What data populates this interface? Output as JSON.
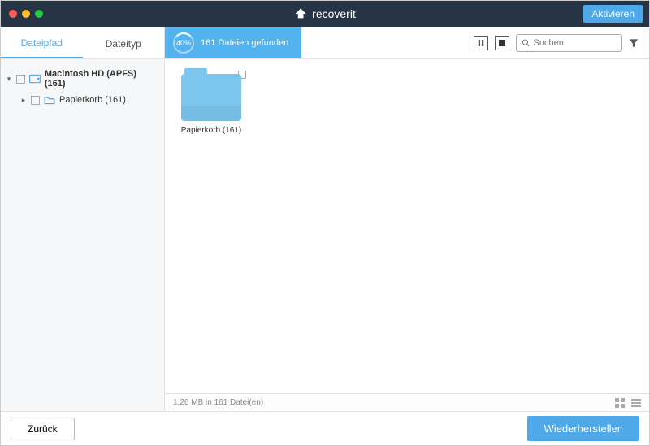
{
  "header": {
    "app_name": "recoverit",
    "activate_label": "Aktivieren"
  },
  "tabs": {
    "filepath": "Dateipfad",
    "filetype": "Dateityp"
  },
  "scan": {
    "percent": "40%",
    "status": "161 Dateien gefunden"
  },
  "search": {
    "placeholder": "Suchen"
  },
  "tree": {
    "root_label": "Macintosh HD (APFS) (161)",
    "child_label": "Papierkorb (161)"
  },
  "grid": {
    "items": [
      {
        "label": "Papierkorb (161)"
      }
    ]
  },
  "status": {
    "text": "1.26 MB in 161 Datei(en)"
  },
  "footer": {
    "back": "Zurück",
    "recover": "Wiederherstellen"
  }
}
